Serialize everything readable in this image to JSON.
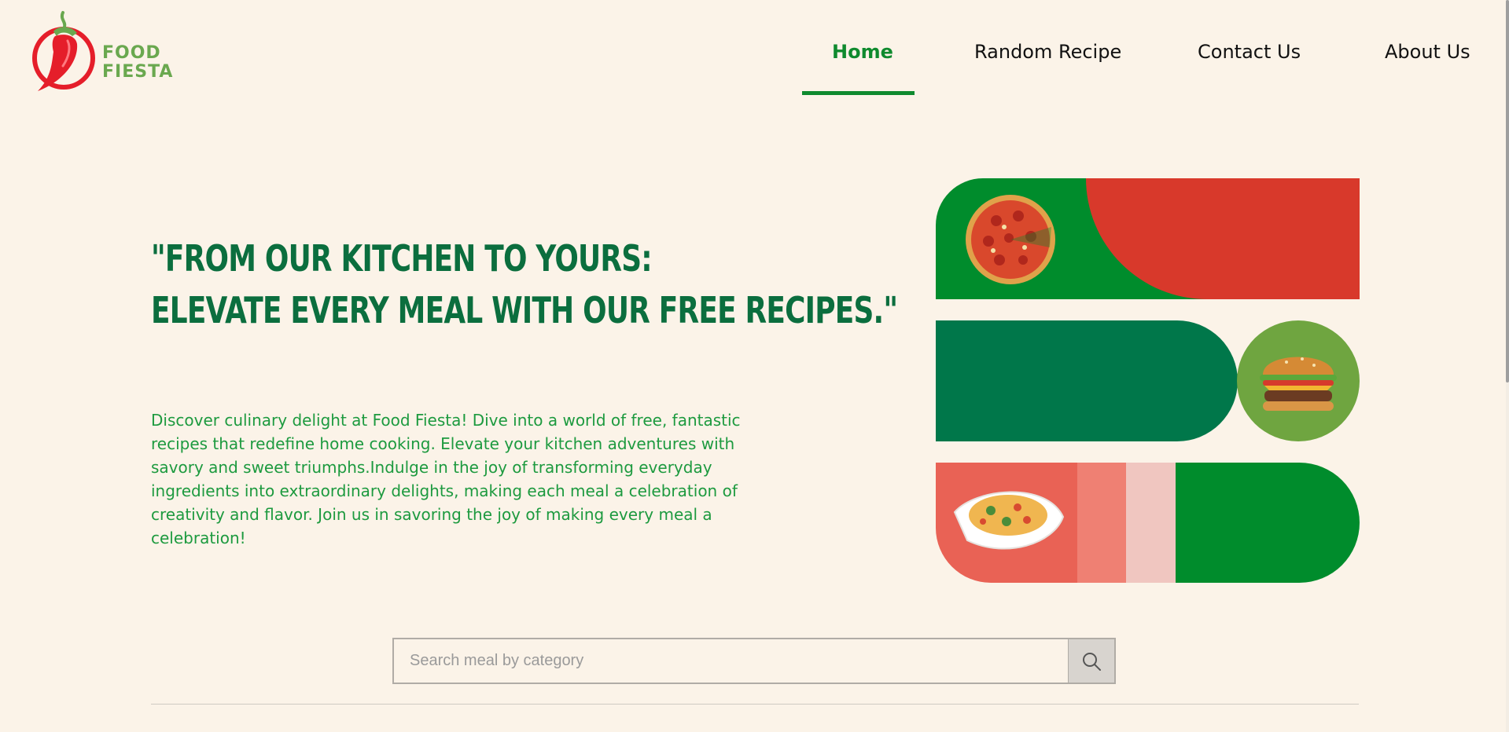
{
  "brand": {
    "line1": "FOOD",
    "line2": "FIESTA",
    "logo_icon": "chili-pepper-icon"
  },
  "nav": {
    "items": [
      {
        "label": "Home",
        "active": true
      },
      {
        "label": "Random Recipe",
        "active": false
      },
      {
        "label": "Contact Us",
        "active": false
      },
      {
        "label": "About Us",
        "active": false
      }
    ]
  },
  "hero": {
    "title_line1": "\"FROM OUR KITCHEN TO YOURS:",
    "title_line2": "ELEVATE EVERY MEAL WITH OUR FREE RECIPES.\"",
    "description": "Discover culinary delight at Food Fiesta! Dive into a world of free, fantastic recipes that redefine home cooking. Elevate your kitchen adventures with savory and sweet triumphs.Indulge in the joy of transforming everyday ingredients into extraordinary delights, making each meal a celebration of creativity and flavor. Join us in savoring the joy of making every meal a celebration!"
  },
  "collage": {
    "images": [
      "pizza-image",
      "burger-image",
      "pasta-bowl-image"
    ],
    "colors": {
      "green": "#008c2c",
      "red": "#d8392b",
      "dark_green": "#00774a",
      "olive": "#6fa540",
      "salmon": "#e96255",
      "light_salmon": "#ef8073",
      "pink": "#f0c6c0"
    }
  },
  "search": {
    "placeholder": "Search meal by category",
    "icon": "search-icon"
  },
  "colors": {
    "background": "#fbf3e8",
    "accent": "#0f8a2e",
    "title": "#0b6e3e",
    "text": "#1d9a3f"
  }
}
